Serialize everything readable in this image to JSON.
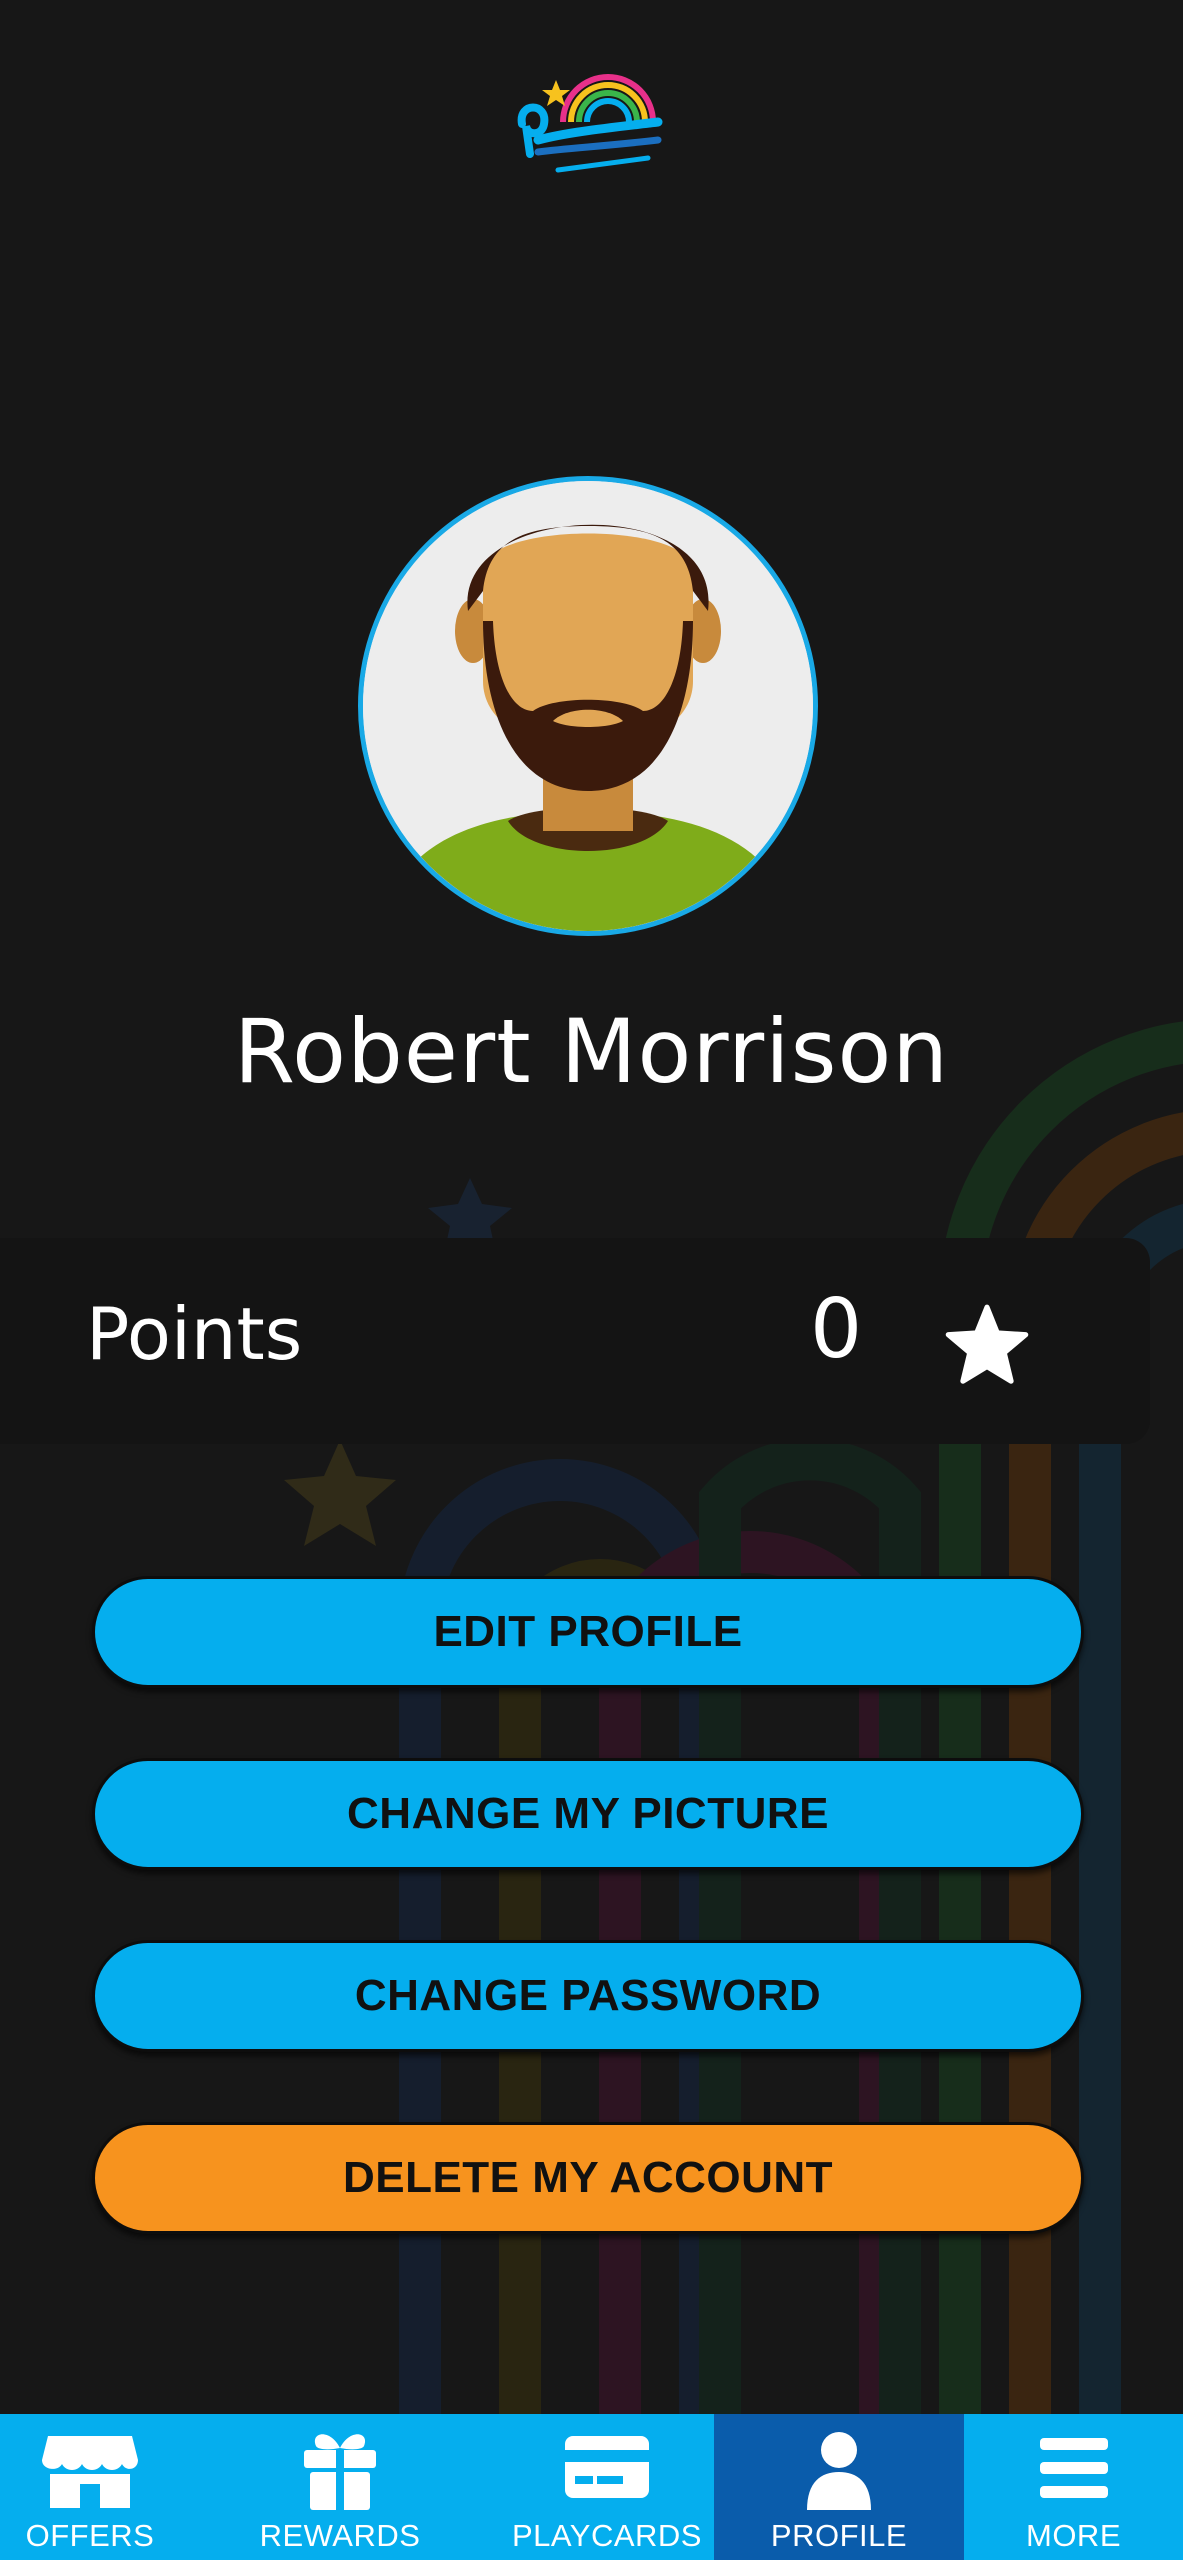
{
  "brand": {
    "logo_icon": "piccadilly-logo",
    "accent_color": "#05aeee",
    "danger_color": "#f7931e"
  },
  "profile": {
    "avatar_icon": "bearded-man-avatar",
    "name": "Robert Morrison"
  },
  "points": {
    "label": "Points",
    "value": "0",
    "icon": "star-icon"
  },
  "actions": {
    "edit_profile": "EDIT PROFILE",
    "change_picture": "CHANGE MY PICTURE",
    "change_password": "CHANGE PASSWORD",
    "delete_account": "DELETE MY ACCOUNT"
  },
  "bottom_nav": {
    "items": [
      {
        "label": "OFFERS",
        "icon": "storefront-icon",
        "active": false
      },
      {
        "label": "REWARDS",
        "icon": "gift-icon",
        "active": false
      },
      {
        "label": "PLAYCARDS",
        "icon": "card-icon",
        "active": false
      },
      {
        "label": "PROFILE",
        "icon": "person-icon",
        "active": true
      },
      {
        "label": "MORE",
        "icon": "menu-icon",
        "active": false
      }
    ]
  }
}
